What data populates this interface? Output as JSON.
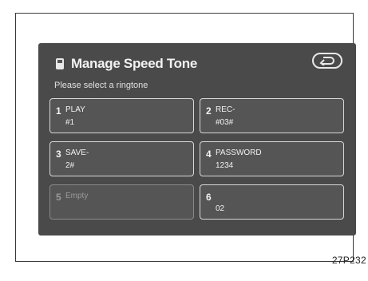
{
  "screen": {
    "title": "Manage Speed Tone",
    "subtitle": "Please select a ringtone"
  },
  "back_icon": "return-arrow-icon",
  "slots": [
    {
      "number": "1",
      "name": "PLAY",
      "code": "#1"
    },
    {
      "number": "2",
      "name": "REC-",
      "code": "#03#"
    },
    {
      "number": "3",
      "name": "SAVE-",
      "code": "2#"
    },
    {
      "number": "4",
      "name": "PASSWORD",
      "code": "1234"
    },
    {
      "number": "5",
      "name": "Empty",
      "code": ""
    },
    {
      "number": "6",
      "name": "",
      "code": "02"
    }
  ],
  "figure_code": "27P232"
}
